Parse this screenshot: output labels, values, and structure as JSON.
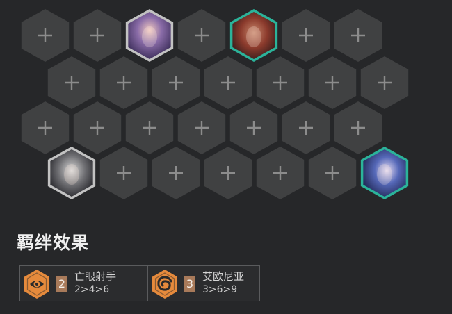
{
  "board": {
    "rows": [
      [
        {
          "type": "empty"
        },
        {
          "type": "empty"
        },
        {
          "type": "champion",
          "name": "irelia",
          "border": "#c2c2c2",
          "palette": "violet"
        },
        {
          "type": "empty"
        },
        {
          "type": "champion",
          "name": "sett",
          "border": "#2bb39a",
          "palette": "red"
        },
        {
          "type": "empty"
        },
        {
          "type": "empty"
        }
      ],
      [
        {
          "type": "empty"
        },
        {
          "type": "empty"
        },
        {
          "type": "empty"
        },
        {
          "type": "empty"
        },
        {
          "type": "empty"
        },
        {
          "type": "empty"
        },
        {
          "type": "empty"
        }
      ],
      [
        {
          "type": "empty"
        },
        {
          "type": "empty"
        },
        {
          "type": "empty"
        },
        {
          "type": "empty"
        },
        {
          "type": "empty"
        },
        {
          "type": "empty"
        },
        {
          "type": "empty"
        }
      ],
      [
        {
          "type": "champion",
          "name": "jhin",
          "border": "#c2c2c2",
          "palette": "grey"
        },
        {
          "type": "empty"
        },
        {
          "type": "empty"
        },
        {
          "type": "empty"
        },
        {
          "type": "empty"
        },
        {
          "type": "empty"
        },
        {
          "type": "champion",
          "name": "ashe",
          "border": "#2bb39a",
          "palette": "blue"
        }
      ]
    ]
  },
  "synergy": {
    "title": "羁绊效果",
    "traits": [
      {
        "name": "亡眼射手",
        "count": "2",
        "levels": "2>4>6",
        "icon": "eye-icon",
        "color": "#e58a3c"
      },
      {
        "name": "艾欧尼亚",
        "count": "3",
        "levels": "3>6>9",
        "icon": "swirl-icon",
        "color": "#e58a3c"
      }
    ]
  }
}
